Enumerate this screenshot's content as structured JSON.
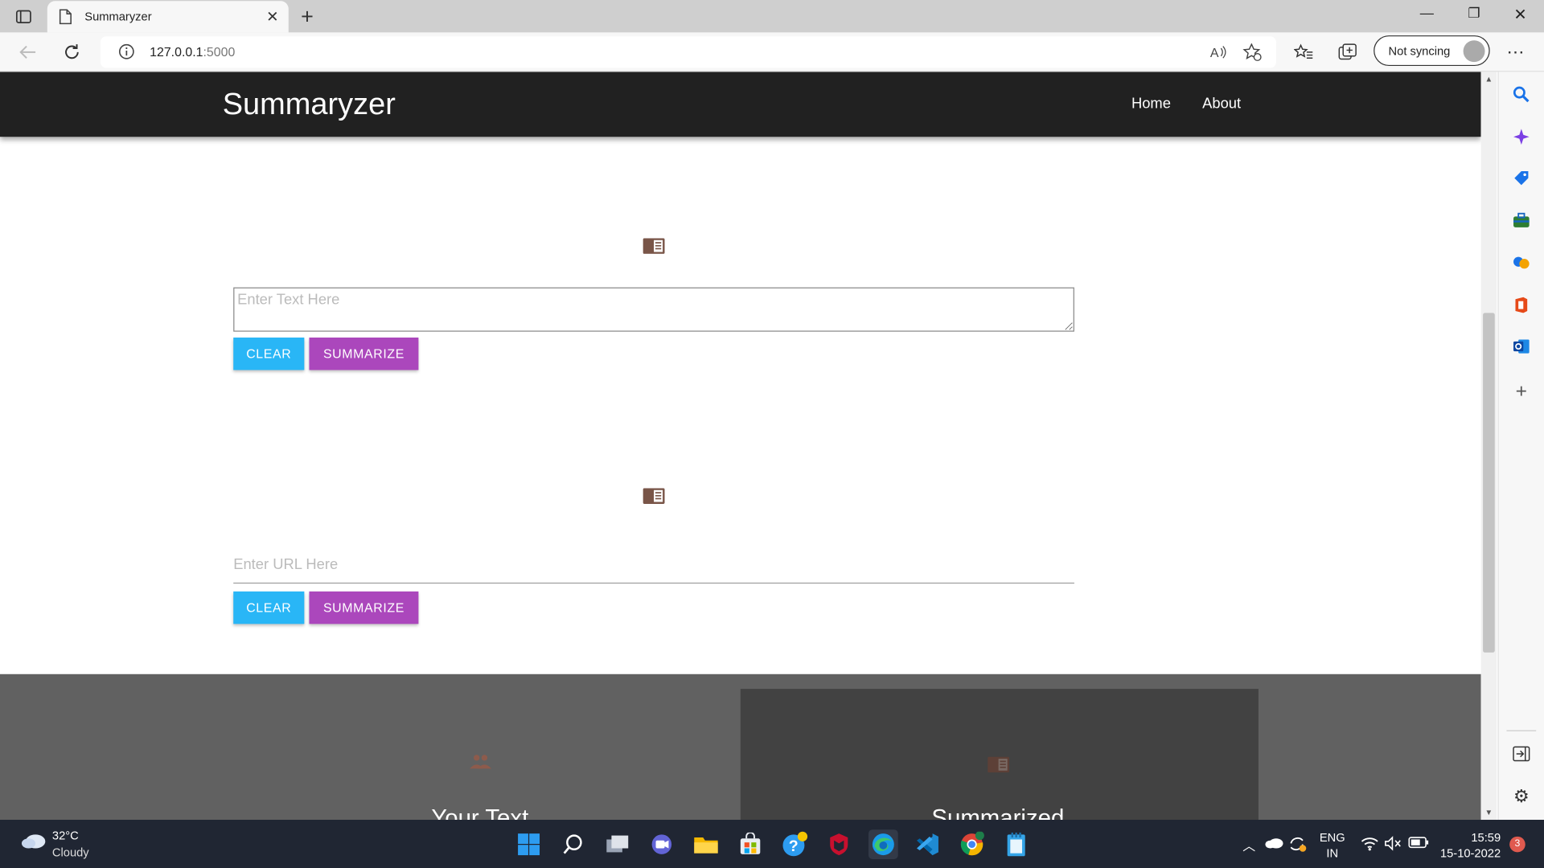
{
  "browser": {
    "tab_title": "Summaryzer",
    "url_host": "127.0.0.1",
    "url_port": ":5000",
    "sync_label": "Not syncing"
  },
  "app": {
    "brand": "Summaryzer",
    "nav": {
      "home": "Home",
      "about": "About"
    },
    "text_section": {
      "placeholder": "Enter Text Here",
      "clear_label": "CLEAR",
      "summarize_label": "SUMMARIZE"
    },
    "url_section": {
      "placeholder": "Enter URL Here",
      "clear_label": "CLEAR",
      "summarize_label": "SUMMARIZE"
    },
    "footer": {
      "col1_heading": "Your Text",
      "col2_heading": "Summarized"
    }
  },
  "taskbar": {
    "weather_temp": "32°C",
    "weather_cond": "Cloudy",
    "lang_line1": "ENG",
    "lang_line2": "IN",
    "time": "15:59",
    "date": "15-10-2022",
    "notification_count": "3"
  },
  "colors": {
    "navbar": "#212121",
    "clear_button": "#29b6f6",
    "summarize_button": "#ab47bc",
    "footer": "#616161",
    "footer_dark": "#424242",
    "section_icon": "#795548"
  }
}
